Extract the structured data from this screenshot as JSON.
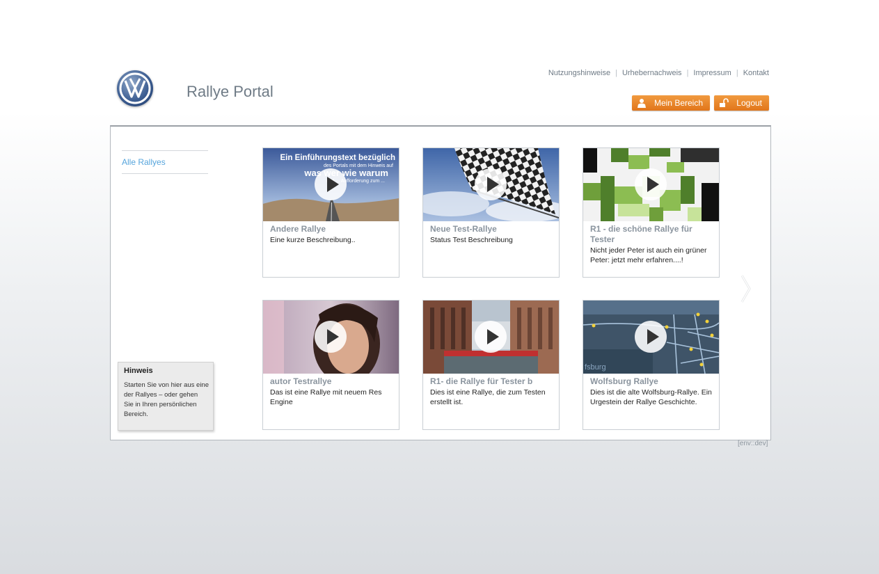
{
  "header": {
    "title": "Rallye Portal",
    "meta_nav": [
      "Nutzungshinweise",
      "Urhebernachweis",
      "Impressum",
      "Kontakt"
    ],
    "buttons": {
      "mein_bereich": "Mein Bereich",
      "logout": "Logout"
    }
  },
  "sidebar": {
    "nav_link": "Alle Rallyes",
    "hint_title": "Hinweis",
    "hint_text": "Starten Sie von hier aus eine der Rallyes – oder gehen Sie in Ihren persönlichen Bereich."
  },
  "thumbnail_overlay": {
    "line1": "Ein Einführungstext bezüglich",
    "line2": "des Portals mit dem Hinweis auf",
    "line3": "was wer wie warum",
    "line4": "und ... Aufforderung zum ..."
  },
  "rallies": [
    {
      "title": "Andere Rallye",
      "description": "Eine kurze Beschreibung.."
    },
    {
      "title": "Neue Test-Rallye",
      "description": "Status Test Beschreibung"
    },
    {
      "title": "R1 - die schöne Rallye für Tester",
      "description": "Nicht jeder Peter ist auch ein grüner Peter: jetzt mehr erfahren....!"
    },
    {
      "title": "autor Testrallye",
      "description": "Das ist eine Rallye mit neuem Res Engine"
    },
    {
      "title": "R1- die Rallye für Tester b",
      "description": "Dies ist eine Rallye, die zum Testen erstellt ist."
    },
    {
      "title": "Wolfsburg Rallye",
      "description": "Dies ist die alte Wolfsburg-Rallye. Ein Urgestein der Rallye Geschichte."
    }
  ],
  "map_label": "fsburg",
  "footer": {
    "env": "[env::dev]"
  },
  "colors": {
    "accent_orange": "#e8831f",
    "link_blue": "#55a4dc",
    "title_gray": "#6f7b86"
  }
}
